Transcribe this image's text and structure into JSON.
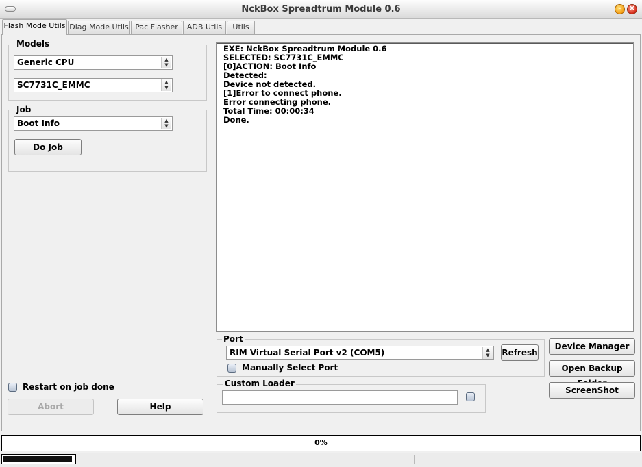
{
  "window": {
    "title": "NckBox Spreadtrum Module 0.6",
    "minimize_glyph": "-",
    "close_glyph": "×"
  },
  "tabs": [
    {
      "label": "Flash Mode Utils",
      "active": true
    },
    {
      "label": "Diag Mode Utils",
      "active": false
    },
    {
      "label": "Pac Flasher",
      "active": false
    },
    {
      "label": "ADB Utils",
      "active": false
    },
    {
      "label": "Utils",
      "active": false
    }
  ],
  "models": {
    "title": "Models",
    "cpu_value": "Generic CPU",
    "model_value": "SC7731C_EMMC"
  },
  "job": {
    "title": "Job",
    "job_value": "Boot Info",
    "do_job_label": "Do Job"
  },
  "log": {
    "lines": [
      "EXE: NckBox Spreadtrum Module 0.6",
      "SELECTED: SC7731C_EMMC",
      "[0]ACTION: Boot Info",
      "Detected:",
      "Device not detected.",
      "[1]Error to connect phone.",
      "Error connecting phone.",
      "Total Time: 00:00:34",
      "Done."
    ]
  },
  "port": {
    "title": "Port",
    "value": "RIM Virtual Serial Port v2 (COM5)",
    "refresh_label": "Refresh",
    "manual_label": "Manually Select Port"
  },
  "custom_loader": {
    "title": "Custom Loader",
    "value": ""
  },
  "actions": {
    "device_manager": "Device Manager",
    "open_backup": "Open Backup Folder",
    "screenshot": "ScreenShot"
  },
  "bottom_left": {
    "restart_label": "Restart on job done",
    "abort_label": "Abort",
    "help_label": "Help"
  },
  "progress": {
    "text": "0%",
    "fraction": 0
  },
  "icons": {
    "combo_arrow": "combo-arrow-icon",
    "menu": "window-menu-icon"
  }
}
